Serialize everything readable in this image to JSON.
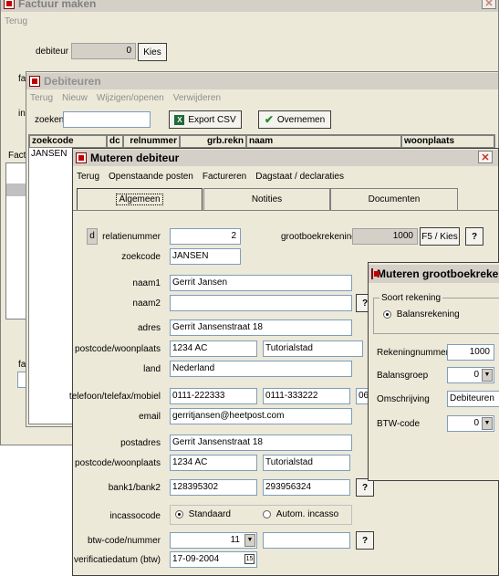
{
  "factuur": {
    "title": "Factuur maken",
    "menu": [
      "Terug"
    ],
    "debiteur_label": "debiteur",
    "debiteur_value": "0",
    "kies_label": "Kies",
    "label_fa": "fa",
    "label_in": "in",
    "label_factu": "Factu",
    "label_fa2": "fa"
  },
  "debiteuren": {
    "title": "Debiteuren",
    "menu": [
      "Terug",
      "Nieuw",
      "Wijzigen/openen",
      "Verwijderen"
    ],
    "zoeken_label": "zoeken",
    "zoeken_value": "",
    "export_label": "Export CSV",
    "overnemen_label": "Overnemen",
    "columns": [
      "zoekcode",
      "dc",
      "relnummer",
      "grb.rekn",
      "naam",
      "woonplaats"
    ],
    "rows": [
      [
        "JANSEN",
        "",
        "",
        "",
        "",
        ""
      ]
    ]
  },
  "mutdeb": {
    "title": "Muteren debiteur",
    "menu": [
      "Terug",
      "Openstaande posten",
      "Factureren",
      "Dagstaat / declaraties"
    ],
    "tabs": [
      "Algemeen",
      "Notities",
      "Documenten"
    ],
    "d_box": "d",
    "labels": {
      "relatienummer": "relatienummer",
      "zoekcode": "zoekcode",
      "grootboekrekening": "grootboekrekening",
      "naam1": "naam1",
      "naam2": "naam2",
      "adres": "adres",
      "postcode": "postcode/woonplaats",
      "land": "land",
      "telefoon": "telefoon/telefax/mobiel",
      "email": "email",
      "postadres": "postadres",
      "postcode2": "postcode/woonplaats",
      "bank": "bank1/bank2",
      "incasso": "incassocode",
      "btw": "btw-code/nummer",
      "verificatie": "verificatiedatum (btw)"
    },
    "values": {
      "relatienummer": "2",
      "zoekcode": "JANSEN",
      "grootboekrekening": "1000",
      "naam1": "Gerrit Jansen",
      "naam2": "",
      "adres": "Gerrit Jansenstraat 18",
      "postcode": "1234 AC",
      "woonplaats": "Tutorialstad",
      "land": "Nederland",
      "telefoon": "0111-222333",
      "telefax": "0111-333222",
      "mobiel": "06",
      "email": "gerritjansen@heetpost.com",
      "postadres": "Gerrit Jansenstraat 18",
      "postcode2": "1234 AC",
      "woonplaats2": "Tutorialstad",
      "bank1": "128395302",
      "bank2": "293956324",
      "btw_code": "11",
      "btw_nummer": "",
      "verificatie": "17-09-2004"
    },
    "f5_label": "F5 / Kies",
    "question": "?",
    "incasso_options": [
      "Standaard",
      "Autom. incasso"
    ],
    "incasso_selected": "Standaard"
  },
  "mutgb": {
    "title": "Muteren grootboekrekeni",
    "soort_label": "Soort rekening",
    "balans_label": "Balansrekening",
    "labels": {
      "rekeningnummer": "Rekeningnummer",
      "balansgroep": "Balansgroep",
      "omschrijving": "Omschrijving",
      "btw": "BTW-code"
    },
    "values": {
      "rekeningnummer": "1000",
      "balansgroep": "0",
      "omschrijving": "Debiteuren",
      "btw": "0"
    }
  }
}
